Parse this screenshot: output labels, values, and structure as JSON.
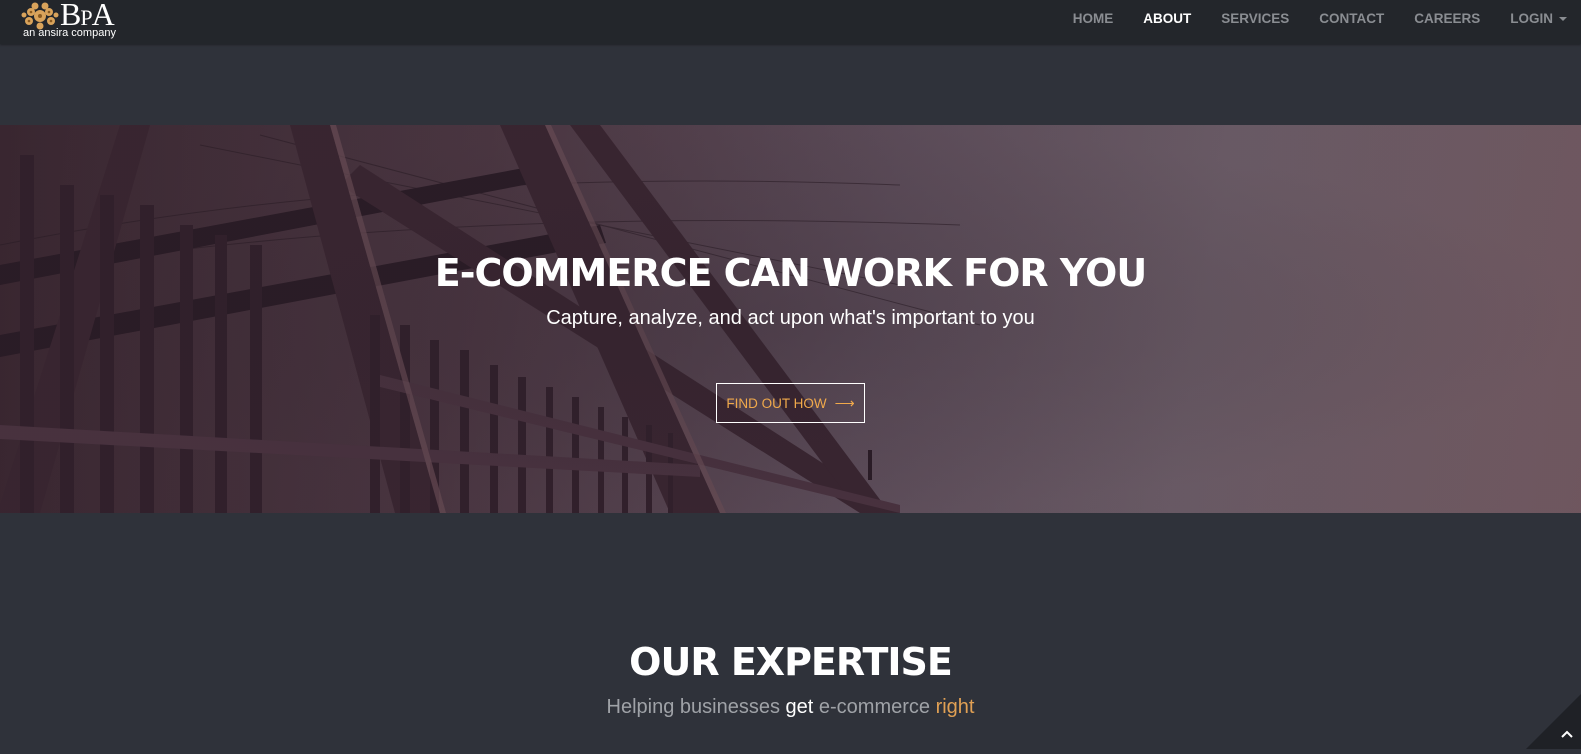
{
  "brand": {
    "letters_b": "B",
    "letters_p": "P",
    "letters_a": "A",
    "tagline": "an ansira company",
    "logo_icon": "ornamental-emblem-icon",
    "emblem_color": "#d9a35b"
  },
  "nav": {
    "items": [
      {
        "label": "HOME",
        "active": false
      },
      {
        "label": "ABOUT",
        "active": true
      },
      {
        "label": "SERVICES",
        "active": false
      },
      {
        "label": "CONTACT",
        "active": false
      },
      {
        "label": "CAREERS",
        "active": false
      },
      {
        "label": "LOGIN",
        "active": false,
        "dropdown": true
      }
    ]
  },
  "hero": {
    "title": "E-COMMERCE CAN WORK FOR YOU",
    "subtitle": "Capture, analyze, and act upon what's important to you",
    "button_label": "FIND OUT HOW",
    "button_arrow": "⟶",
    "background_image": "steel-frame-construction-photo"
  },
  "expertise": {
    "title": "OUR EXPERTISE",
    "subtitle_parts": [
      "Helping businesses ",
      "get",
      " e-commerce ",
      "right"
    ]
  },
  "scroll_top": {
    "icon": "chevron-up-icon"
  },
  "colors": {
    "page_bg": "#2f323a",
    "navbar_bg": "#23262b",
    "accent_orange": "#f0a94b",
    "muted_text": "#9fa2a7"
  }
}
